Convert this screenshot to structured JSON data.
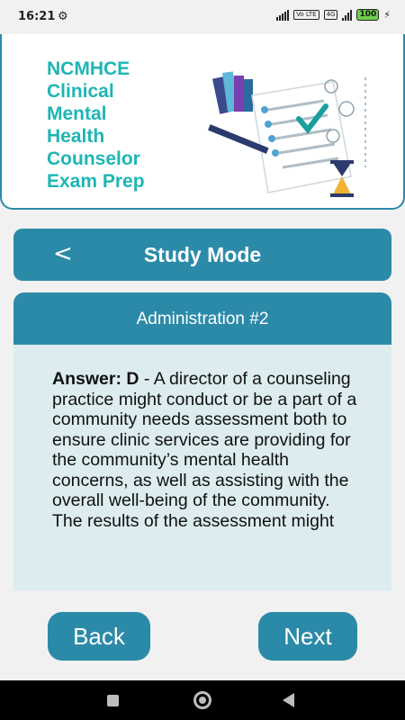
{
  "status_bar": {
    "time": "16:21",
    "settings_icon": "gear-icon",
    "network_tags": [
      "Vo LTE",
      "4G"
    ],
    "battery": "100"
  },
  "header": {
    "title_lines": [
      "NCMHCE",
      "Clinical",
      "Mental",
      "Health",
      "Counselor",
      "Exam Prep"
    ],
    "illustration": "exam-checklist-illustration",
    "accent_color": "#1fb5b5"
  },
  "study_bar": {
    "back_icon": "chevron-left-icon",
    "back_glyph": "<",
    "title": "Study Mode"
  },
  "question": {
    "title": "Administration #2",
    "answer_label": "Answer: D",
    "answer_text": " - A director of a counseling practice might conduct or be a part of a community needs assessment both to ensure clinic services are providing for the community’s mental health concerns, as well as assisting with the overall well-being of the community. The results of the assessment might"
  },
  "navigation": {
    "back_label": "Back",
    "next_label": "Next"
  },
  "theme": {
    "primary": "#2b8aa8",
    "card_background": "#dcecef",
    "page_background": "#f1f1f1"
  }
}
